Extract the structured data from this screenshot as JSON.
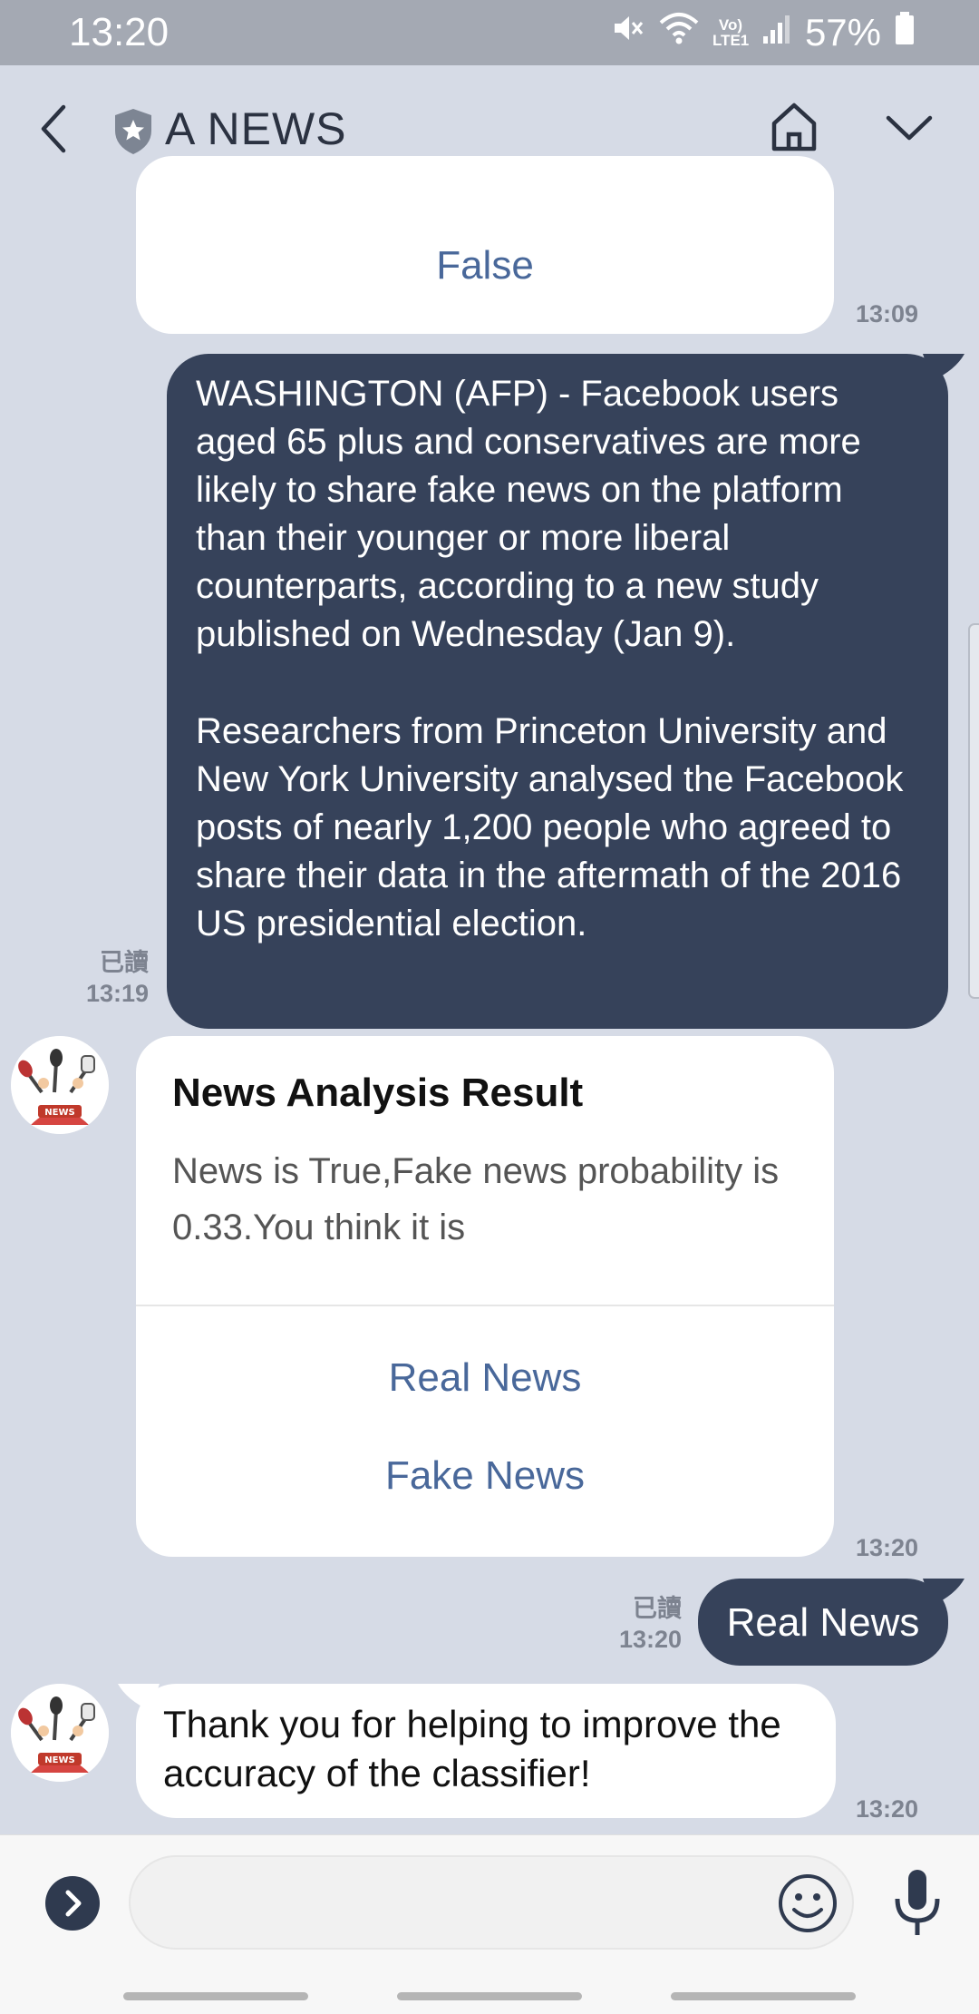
{
  "status_bar": {
    "time": "13:20",
    "battery": "57%",
    "network": "Vo) LTE1"
  },
  "header": {
    "title": "A NEWS"
  },
  "messages": {
    "bot_false": {
      "text": "False",
      "time": "13:09"
    },
    "user_article": {
      "paragraph1": "WASHINGTON (AFP) - Facebook users aged 65 plus and conservatives are more likely to share fake news on the platform than their younger or more liberal counterparts, according to a new study published on Wednesday (Jan 9).",
      "paragraph2": "Researchers from Princeton University and New York University analysed the Facebook posts of nearly 1,200 people who agreed to share their data in the aftermath of the 2016 US presidential election.",
      "read_label": "已讀",
      "time": "13:19"
    },
    "analysis_card": {
      "title": "News Analysis Result",
      "body": "News is True,Fake news probability is 0.33.You think it is",
      "options": [
        "Real News",
        "Fake News"
      ],
      "time": "13:20"
    },
    "user_reply": {
      "text": "Real News",
      "read_label": "已讀",
      "time": "13:20"
    },
    "bot_thanks": {
      "text": "Thank you for helping to improve the accuracy of the classifier!",
      "time": "13:20"
    }
  },
  "input": {
    "value": "",
    "placeholder": ""
  },
  "colors": {
    "background": "#d6dbe6",
    "user_bubble": "#36425a",
    "link": "#49689a"
  }
}
